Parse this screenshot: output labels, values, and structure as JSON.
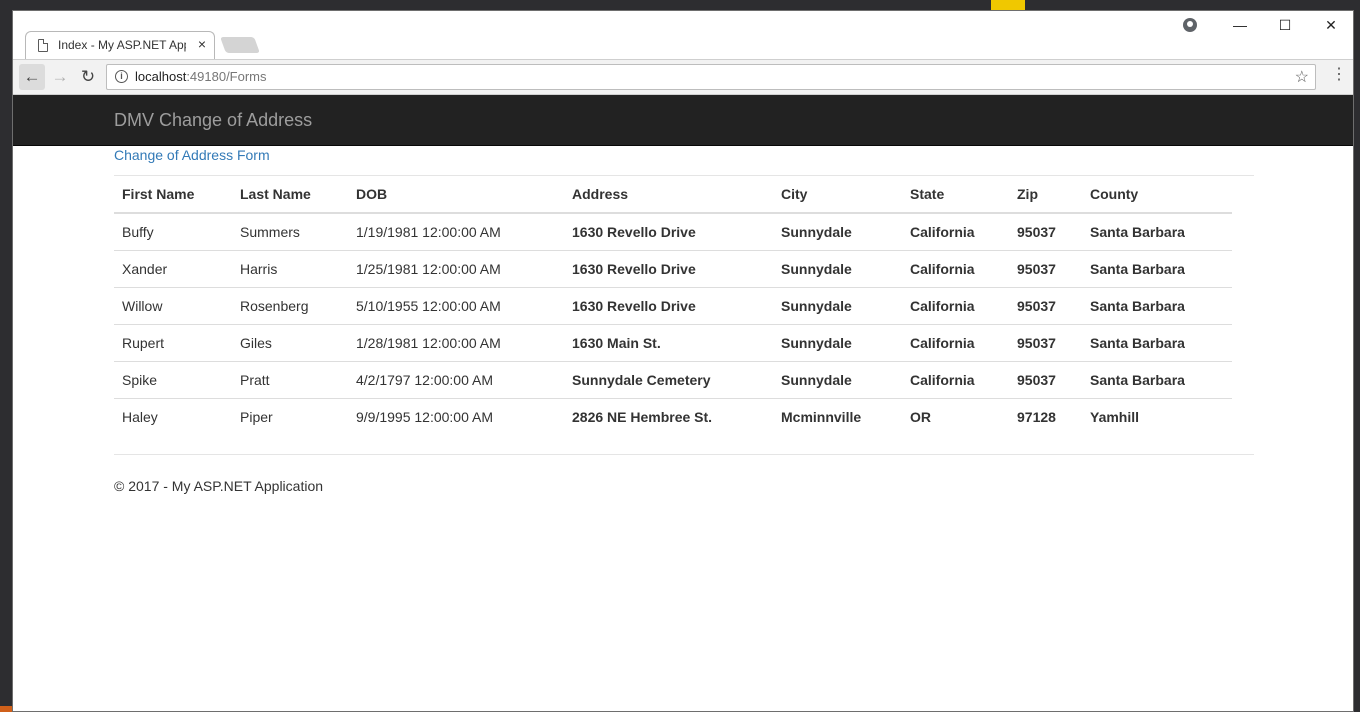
{
  "browser": {
    "tab_title": "Index - My ASP.NET Application",
    "tab_close": "×",
    "url_host": "localhost",
    "url_rest": ":49180/Forms",
    "icons": {
      "back": "back-arrow-icon",
      "forward": "forward-arrow-icon",
      "reload": "reload-icon",
      "info": "info-icon",
      "star": "star-icon",
      "menu": "kebab-menu-icon"
    },
    "window_controls": {
      "minimize": "—",
      "maximize": "☐",
      "close": "✕"
    }
  },
  "navbar": {
    "brand": "DMV Change of Address"
  },
  "page": {
    "link": "Change of Address Form",
    "footer": "© 2017 - My ASP.NET Application"
  },
  "table": {
    "headers": [
      "First Name",
      "Last Name",
      "DOB",
      "Address",
      "City",
      "State",
      "Zip",
      "County"
    ],
    "rows": [
      [
        "Buffy",
        "Summers",
        "1/19/1981 12:00:00 AM",
        "1630 Revello Drive",
        "Sunnydale",
        "California",
        "95037",
        "Santa Barbara"
      ],
      [
        "Xander",
        "Harris",
        "1/25/1981 12:00:00 AM",
        "1630 Revello Drive",
        "Sunnydale",
        "California",
        "95037",
        "Santa Barbara"
      ],
      [
        "Willow",
        "Rosenberg",
        "5/10/1955 12:00:00 AM",
        "1630 Revello Drive",
        "Sunnydale",
        "California",
        "95037",
        "Santa Barbara"
      ],
      [
        "Rupert",
        "Giles",
        "1/28/1981 12:00:00 AM",
        "1630 Main St.",
        "Sunnydale",
        "California",
        "95037",
        "Santa Barbara"
      ],
      [
        "Spike",
        "Pratt",
        "4/2/1797 12:00:00 AM",
        "Sunnydale Cemetery",
        "Sunnydale",
        "California",
        "95037",
        "Santa Barbara"
      ],
      [
        "Haley",
        "Piper",
        "9/9/1995 12:00:00 AM",
        "2826 NE Hembree St.",
        "Mcminnville",
        "OR",
        "97128",
        "Yamhill"
      ]
    ]
  },
  "colors": {
    "navbar_bg": "#222222",
    "brand_text": "#9d9d9d",
    "link": "#337ab7",
    "text": "#333333"
  }
}
